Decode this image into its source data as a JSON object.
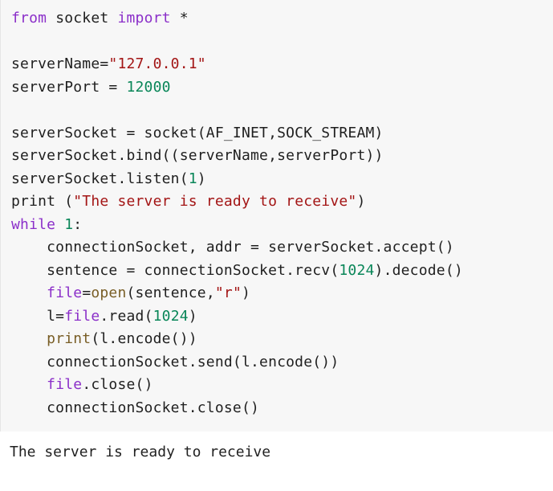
{
  "code_cell": {
    "colors": {
      "keyword": "#8b2fc9",
      "string": "#a31515",
      "number": "#098658",
      "builtin": "#795e26",
      "name": "#1f1f1f",
      "operator": "#1f1f1f",
      "background": "#f7f7f7"
    },
    "lines": [
      [
        {
          "t": "from",
          "c": "keyword"
        },
        {
          "t": " socket ",
          "c": "name"
        },
        {
          "t": "import",
          "c": "keyword"
        },
        {
          "t": " *",
          "c": "operator"
        }
      ],
      [],
      [
        {
          "t": "serverName=",
          "c": "name"
        },
        {
          "t": "\"127.0.0.1\"",
          "c": "string"
        }
      ],
      [
        {
          "t": "serverPort = ",
          "c": "name"
        },
        {
          "t": "12000",
          "c": "number"
        }
      ],
      [],
      [
        {
          "t": "serverSocket = socket(AF_INET,SOCK_STREAM)",
          "c": "name"
        }
      ],
      [
        {
          "t": "serverSocket.bind((serverName,serverPort))",
          "c": "name"
        }
      ],
      [
        {
          "t": "serverSocket.listen(",
          "c": "name"
        },
        {
          "t": "1",
          "c": "number"
        },
        {
          "t": ")",
          "c": "name"
        }
      ],
      [
        {
          "t": "print (",
          "c": "name"
        },
        {
          "t": "\"The server is ready to receive\"",
          "c": "string"
        },
        {
          "t": ")",
          "c": "name"
        }
      ],
      [
        {
          "t": "while",
          "c": "keyword"
        },
        {
          "t": " ",
          "c": "name"
        },
        {
          "t": "1",
          "c": "number"
        },
        {
          "t": ":",
          "c": "name"
        }
      ],
      [
        {
          "t": "    connectionSocket, addr = serverSocket.accept()",
          "c": "name"
        }
      ],
      [
        {
          "t": "    sentence = connectionSocket.recv(",
          "c": "name"
        },
        {
          "t": "1024",
          "c": "number"
        },
        {
          "t": ").decode()",
          "c": "name"
        }
      ],
      [
        {
          "t": "    ",
          "c": "name"
        },
        {
          "t": "file",
          "c": "keyword"
        },
        {
          "t": "=",
          "c": "name"
        },
        {
          "t": "open",
          "c": "builtin"
        },
        {
          "t": "(sentence,",
          "c": "name"
        },
        {
          "t": "\"r\"",
          "c": "string"
        },
        {
          "t": ")",
          "c": "name"
        }
      ],
      [
        {
          "t": "    l=",
          "c": "name"
        },
        {
          "t": "file",
          "c": "keyword"
        },
        {
          "t": ".read(",
          "c": "name"
        },
        {
          "t": "1024",
          "c": "number"
        },
        {
          "t": ")",
          "c": "name"
        }
      ],
      [
        {
          "t": "    ",
          "c": "name"
        },
        {
          "t": "print",
          "c": "builtin"
        },
        {
          "t": "(l.encode())",
          "c": "name"
        }
      ],
      [
        {
          "t": "    connectionSocket.send(l.encode())",
          "c": "name"
        }
      ],
      [
        {
          "t": "    ",
          "c": "name"
        },
        {
          "t": "file",
          "c": "keyword"
        },
        {
          "t": ".close()",
          "c": "name"
        }
      ],
      [
        {
          "t": "    connectionSocket.close()",
          "c": "name"
        }
      ]
    ]
  },
  "output": {
    "text": "The server is ready to receive"
  }
}
